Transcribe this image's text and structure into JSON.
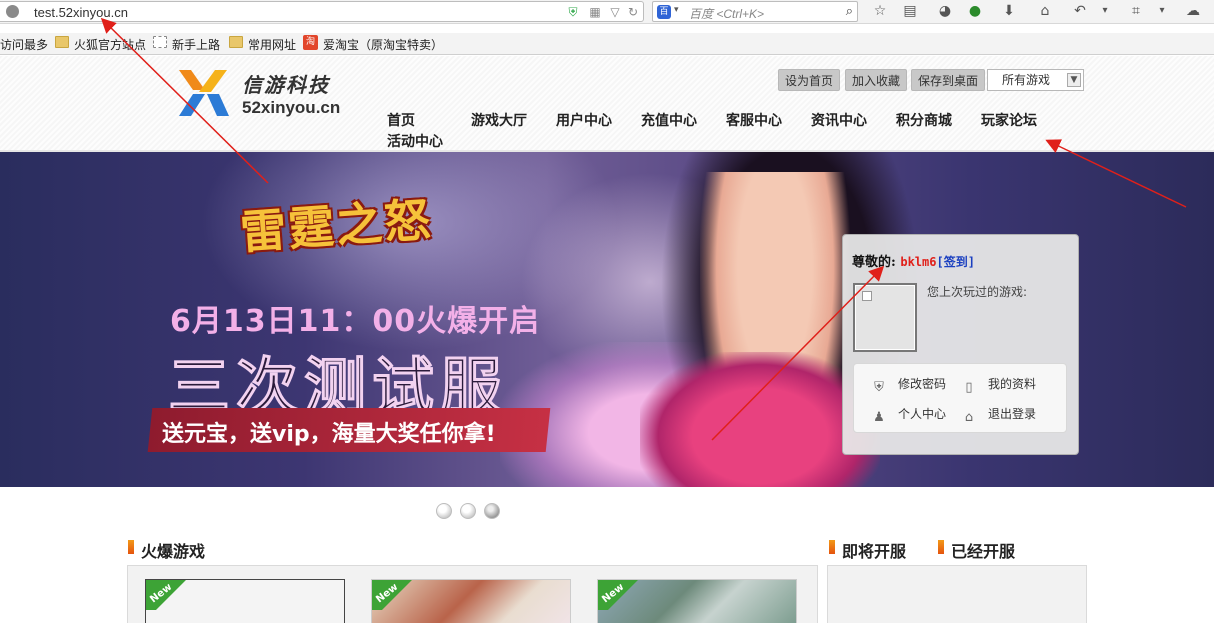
{
  "browser": {
    "url": "test.52xinyou.cn",
    "search_placeholder": "百度 <Ctrl+K>",
    "bookmarks": [
      "访问最多",
      "火狐官方站点",
      "新手上路",
      "常用网址",
      "爱淘宝（原淘宝特卖）"
    ],
    "taobao_icon_text": "淘"
  },
  "site": {
    "logo_cn": "信游科技",
    "logo_en": "52xinyou.cn",
    "top_buttons": [
      "设为首页",
      "加入收藏",
      "保存到桌面"
    ],
    "game_select": "所有游戏",
    "nav": [
      "首页",
      "游戏大厅",
      "用户中心",
      "充值中心",
      "客服中心",
      "资讯中心",
      "积分商城",
      "玩家论坛",
      "活动中心"
    ]
  },
  "banner": {
    "title_art": "雷霆之怒",
    "date_text": "6月13日11：00火爆开启",
    "big_text": "三次测试服",
    "red_bar_text": "送元宝，送vip，海量大奖任你拿!"
  },
  "login_panel": {
    "greeting": "尊敬的:",
    "username": "bklm6",
    "sign_in": "[签到]",
    "last_played": "您上次玩过的游戏:",
    "menu": {
      "change_password": "修改密码",
      "my_profile": "我的资料",
      "personal_center": "个人中心",
      "logout": "退出登录"
    }
  },
  "carousel": {
    "slides": 3,
    "active_index": 2
  },
  "sections": {
    "hot_games": "火爆游戏",
    "coming_soon": "即将开服",
    "already_open": "已经开服",
    "new_tag": "New"
  },
  "colors": {
    "accent_orange": "#f39a18",
    "arrow_red": "#e0201a",
    "username_red": "#e0201a",
    "sign_blue": "#1a3fc0",
    "new_green": "#3da336"
  }
}
